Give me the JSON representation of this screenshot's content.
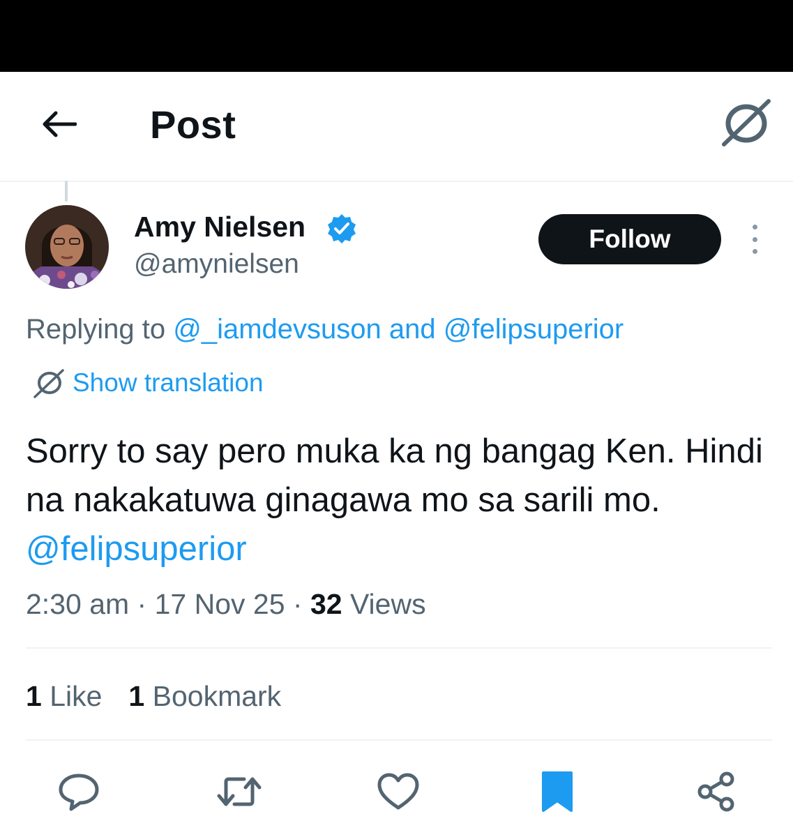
{
  "header": {
    "title": "Post"
  },
  "author": {
    "display_name": "Amy Nielsen",
    "handle": "@amynielsen",
    "verified": true,
    "follow_label": "Follow"
  },
  "reply": {
    "prefix": "Replying to ",
    "mention1": "@_iamdevsuson",
    "joiner": " and ",
    "mention2": "@felipsuperior"
  },
  "translation": {
    "label": "Show translation"
  },
  "tweet": {
    "text": "Sorry to say pero muka ka ng bangag Ken. Hindi na nakakatuwa ginagawa mo sa sarili mo. ",
    "mention": "@felipsuperior"
  },
  "meta": {
    "time": "2:30 am",
    "date": "17 Nov 25",
    "sep": " · ",
    "views_count": "32",
    "views_label": " Views"
  },
  "stats": {
    "likes_count": "1",
    "likes_label": " Like",
    "bookmarks_count": "1",
    "bookmarks_label": " Bookmark"
  },
  "colors": {
    "accent": "#1d9bf0",
    "text": "#0f1419",
    "secondary": "#536471",
    "divider": "#eff3f4"
  },
  "icons": [
    "back-arrow-icon",
    "translate-icon",
    "verified-badge-icon",
    "more-icon",
    "reply-icon",
    "repost-icon",
    "like-icon",
    "bookmark-icon",
    "share-icon"
  ]
}
